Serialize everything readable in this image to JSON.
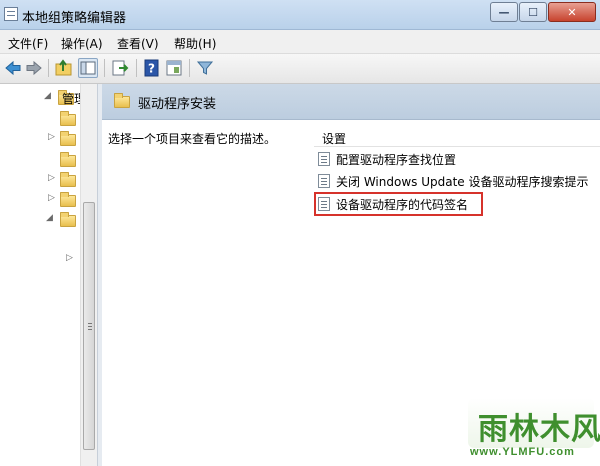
{
  "window": {
    "title": "本地组策略编辑器",
    "controls": {
      "minimize": "—",
      "maximize": "☐",
      "close": "✕"
    }
  },
  "menu": {
    "items": [
      "文件(F)",
      "操作(A)",
      "查看(V)",
      "帮助(H)"
    ]
  },
  "toolbar": {
    "icons": [
      "back-arrow-icon",
      "forward-arrow-icon",
      "up-folder-icon",
      "show-hide-tree-icon",
      "export-list-icon",
      "help-icon",
      "properties-icon",
      "filter-icon"
    ]
  },
  "tree": {
    "root_label": "管理"
  },
  "detail": {
    "header_title": "驱动程序安装",
    "description": "选择一个项目来查看它的描述。",
    "settings_heading": "设置",
    "settings": [
      "配置驱动程序查找位置",
      "关闭 Windows Update 设备驱动程序搜索提示",
      "设备驱动程序的代码签名"
    ],
    "highlighted_index": 2,
    "highlight_color": "#d6322b"
  },
  "watermark": {
    "text": "雨林木风",
    "url": "www.YLMFU.com"
  },
  "colors": {
    "header_bg": "#c4d4e5",
    "folder": "#f2cf63",
    "accent": "#3f8f2e"
  }
}
